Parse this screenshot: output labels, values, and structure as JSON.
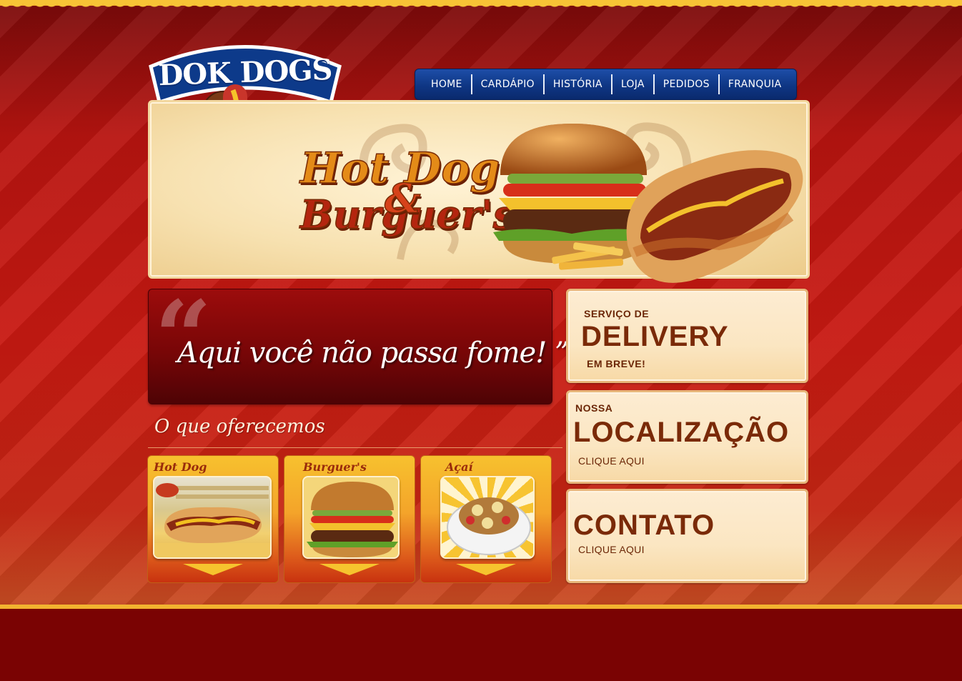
{
  "brand": {
    "logo_text": "DOK DOGS"
  },
  "nav": {
    "items": [
      {
        "label": "HOME"
      },
      {
        "label": "CARDÁPIO"
      },
      {
        "label": "HISTÓRIA"
      },
      {
        "label": "LOJA"
      },
      {
        "label": "PEDIDOS"
      },
      {
        "label": "FRANQUIA"
      }
    ]
  },
  "banner": {
    "line1": "Hot Dog",
    "ampersand": "&",
    "line2": "Burguer's"
  },
  "quote": {
    "text": "Aqui você não passa fome! ”",
    "marks": "“"
  },
  "offer": {
    "title": "O que oferecemos",
    "cards": [
      {
        "label": "Hot Dog"
      },
      {
        "label": "Burguer's"
      },
      {
        "label": "Açaí"
      }
    ]
  },
  "panels": {
    "delivery": {
      "small": "SERVIÇO DE",
      "big": "DELIVERY",
      "sub": "EM BREVE!"
    },
    "location": {
      "small": "NOSSA",
      "big": "LOCALIZAÇÃO",
      "link": "CLIQUE AQUI"
    },
    "contact": {
      "big": "CONTATO",
      "link": "CLIQUE AQUI"
    }
  },
  "colors": {
    "background_red": "#c81912",
    "nav_blue": "#0f3684",
    "footer": "#7a0303",
    "accent_yellow": "#f7c436"
  }
}
